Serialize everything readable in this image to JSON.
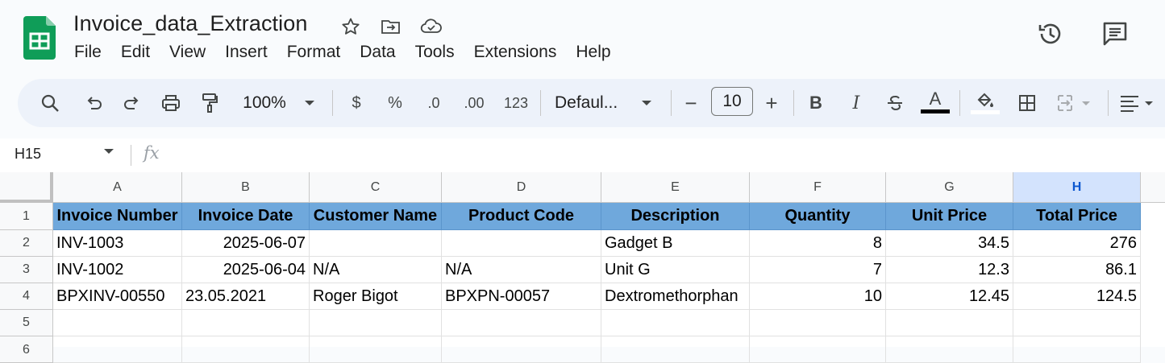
{
  "app": {
    "doc_title": "Invoice_data_Extraction",
    "menu": [
      "File",
      "Edit",
      "View",
      "Insert",
      "Format",
      "Data",
      "Tools",
      "Extensions",
      "Help"
    ],
    "icons": {
      "logo": "sheets-logo-icon",
      "star": "star-icon",
      "move": "move-to-folder-icon",
      "cloud": "cloud-saved-icon",
      "history": "version-history-icon",
      "comments": "comments-icon"
    }
  },
  "toolbar": {
    "zoom": "100%",
    "currency": "$",
    "percent": "%",
    "dec_decrease": ".0",
    "dec_increase": ".00",
    "number_format": "123",
    "font": "Defaul...",
    "font_size": "10",
    "minus": "−",
    "plus": "+",
    "bold": "B",
    "italic": "I",
    "text_color_letter": "A"
  },
  "formula_bar": {
    "name_box": "H15",
    "fx": "fx"
  },
  "sheet": {
    "columns": [
      "A",
      "B",
      "C",
      "D",
      "E",
      "F",
      "G",
      "H"
    ],
    "selected_column": "H",
    "row_numbers": [
      "1",
      "2",
      "3",
      "4",
      "5",
      "6"
    ],
    "header_row": [
      "Invoice Number",
      "Invoice Date",
      "Customer Name",
      "Product Code",
      "Description",
      "Quantity",
      "Unit Price",
      "Total Price"
    ],
    "rows": [
      [
        "INV-1003",
        "2025-06-07",
        "",
        "",
        "Gadget B",
        "8",
        "34.5",
        "276"
      ],
      [
        "INV-1002",
        "2025-06-04",
        "N/A",
        "N/A",
        "Unit G",
        "7",
        "12.3",
        "86.1"
      ],
      [
        "BPXINV-00550",
        "23.05.2021",
        "Roger Bigot",
        "BPXPN-00057",
        "Dextromethorphan",
        "10",
        "12.45",
        "124.5"
      ]
    ],
    "header_fill": "#6fa8dc"
  }
}
